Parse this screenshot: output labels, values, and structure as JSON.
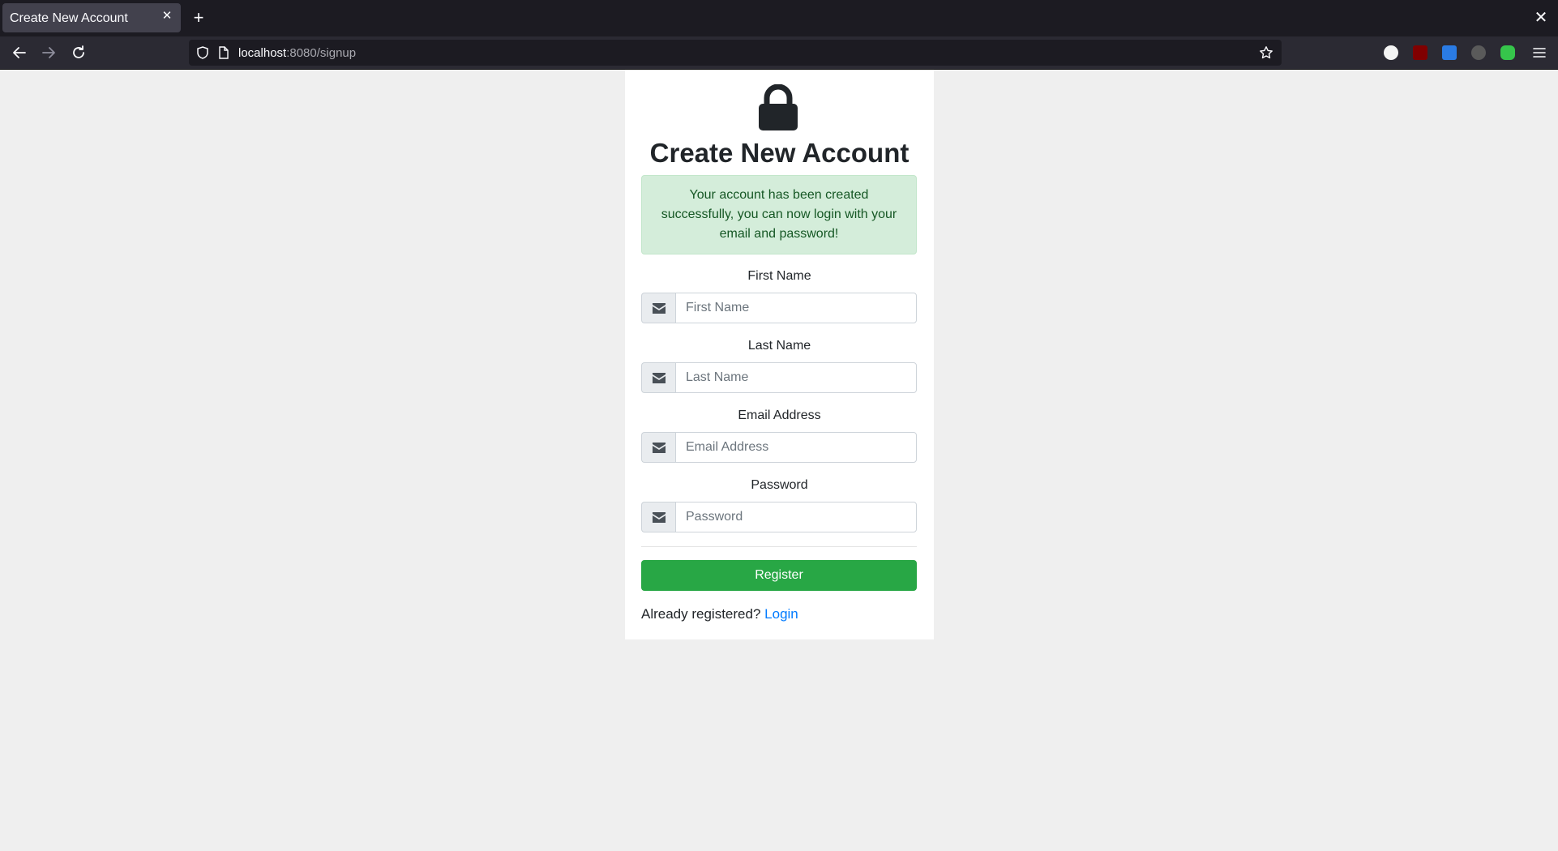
{
  "browser": {
    "tab_title": "Create New Account",
    "tab_close": "✕",
    "new_tab": "+",
    "window_close": "✕",
    "url_host": "localhost",
    "url_path": ":8080/signup"
  },
  "page": {
    "title": "Create New Account",
    "alert_message": "Your account has been created successfully, you can now login with your email and password!",
    "fields": {
      "first_name": {
        "label": "First Name",
        "placeholder": "First Name"
      },
      "last_name": {
        "label": "Last Name",
        "placeholder": "Last Name"
      },
      "email": {
        "label": "Email Address",
        "placeholder": "Email Address"
      },
      "password": {
        "label": "Password",
        "placeholder": "Password"
      }
    },
    "register_label": "Register",
    "already_registered": "Already registered?",
    "login_link": "Login"
  },
  "icons": {
    "field_addon": "envelope-icon",
    "header": "lock-icon"
  },
  "colors": {
    "success_button": "#28a745",
    "alert_bg": "#d4edda",
    "alert_text": "#155724",
    "link": "#007bff"
  }
}
